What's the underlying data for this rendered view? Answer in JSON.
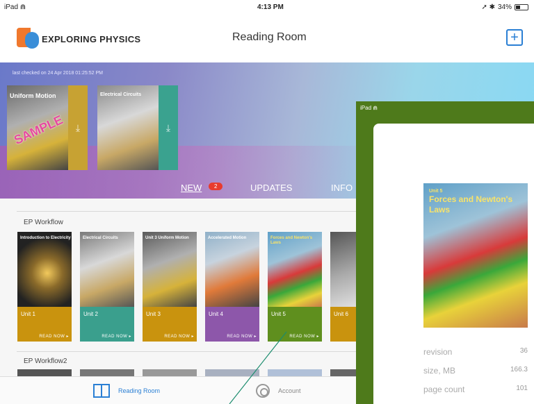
{
  "status_bar": {
    "device": "iPad",
    "time": "4:13 PM",
    "battery": "34%"
  },
  "header": {
    "brand": "EXPLORING PHYSICS",
    "title": "Reading Room",
    "add_icon": "plus-square-icon"
  },
  "hero": {
    "last_checked": "last checked on 24 Apr 2018 01:25:52 PM",
    "books": [
      {
        "title": "Uniform Motion",
        "sample": "SAMPLE",
        "strip_color": "#c7a233"
      },
      {
        "title": "Electrical Circuits",
        "strip_color": "#3aa28f"
      }
    ]
  },
  "segments": {
    "new": "NEW",
    "new_badge": "2",
    "updates": "UPDATES",
    "info": "INFO"
  },
  "sections": [
    {
      "title": "EP Workflow",
      "books": [
        {
          "unit": "Unit 1",
          "title": "Introduction to Electricity",
          "color": "#c9930e"
        },
        {
          "unit": "Unit 2",
          "title": "Electrical Circuits",
          "color": "#3a9f8d"
        },
        {
          "unit": "Unit 3",
          "title": "Unit 3 Uniform Motion",
          "color": "#c9930e"
        },
        {
          "unit": "Unit 4",
          "title": "Accelerated Motion",
          "color": "#8d57aa"
        },
        {
          "unit": "Unit 5",
          "title": "Forces and Newton's Laws",
          "color": "#5f8f1e"
        },
        {
          "unit": "Unit 6",
          "title": "",
          "color": "#c9930e"
        }
      ],
      "read_now": "READ NOW"
    },
    {
      "title": "EP Workflow2"
    }
  ],
  "tabbar": {
    "reading_room": "Reading Room",
    "account": "Account"
  },
  "overlay": {
    "device": "iPad",
    "cover_title": "Forces and Newton's Laws",
    "cover_unit": "Unit 5",
    "revision_label": "revision",
    "revision_value": "36",
    "size_label": "size, MB",
    "size_value": "166.3",
    "pages_label": "page count",
    "pages_value": "101"
  },
  "colors": {
    "accent": "#2a7fd4",
    "overlay_green": "#4e7a1b",
    "badge_red": "#e83b2e"
  }
}
